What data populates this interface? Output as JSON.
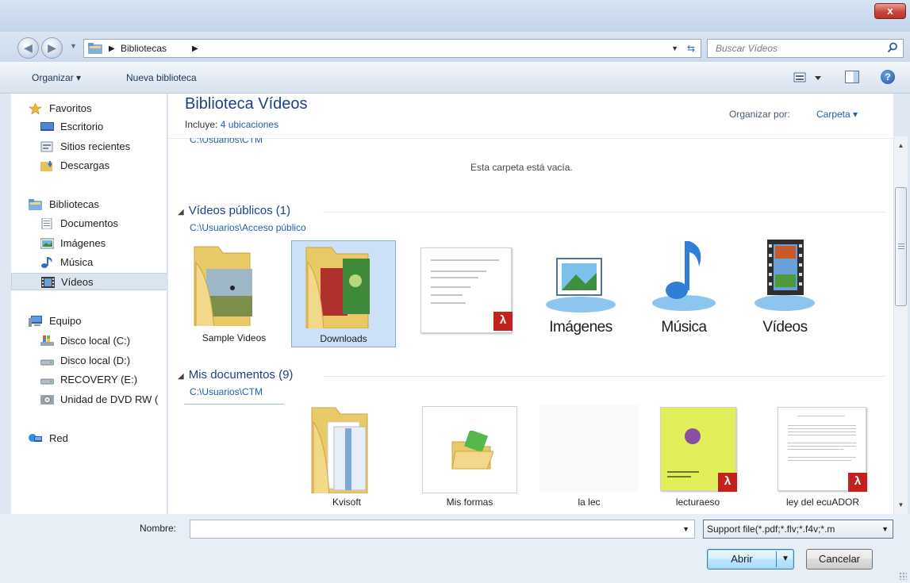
{
  "window": {
    "close_symbol": "x"
  },
  "address": {
    "breadcrumb": "Bibliotecas",
    "search_placeholder": "Buscar Vídeos"
  },
  "toolbar": {
    "organize": "Organizar ▾",
    "new_library": "Nueva biblioteca"
  },
  "nav": {
    "favorites": "Favoritos",
    "desktop": "Escritorio",
    "recent": "Sitios recientes",
    "downloads": "Descargas",
    "libraries": "Bibliotecas",
    "documents": "Documentos",
    "images": "Imágenes",
    "music": "Música",
    "videos": "Vídeos",
    "computer": "Equipo",
    "disk_c": "Disco local (C:)",
    "disk_d": "Disco local (D:)",
    "recovery": "RECOVERY (E:)",
    "dvd": "Unidad de DVD RW (",
    "network": "Red"
  },
  "library": {
    "title": "Biblioteca Vídeos",
    "includes_label": "Incluye:",
    "includes_link": "4 ubicaciones",
    "arrange_label": "Organizar por:",
    "arrange_value": "Carpeta ▾",
    "partial_path": "C:\\Usuarios\\CTM",
    "empty_message": "Esta carpeta está vacía."
  },
  "groups": {
    "public": {
      "title": "Vídeos públicos (1)",
      "path": "C:\\Usuarios\\Acceso público"
    },
    "mydocs": {
      "title": "Mis documentos (9)",
      "path": "C:\\Usuarios\\CTM"
    }
  },
  "public_items": {
    "sample": "Sample Videos",
    "downloads": "Downloads",
    "images": "Imágenes",
    "music": "Música",
    "videos": "Vídeos"
  },
  "doc_items": {
    "kvisoft": "Kvisoft",
    "forms": "Mis formas",
    "lalec": "la lec",
    "lectura": "lecturaeso",
    "ley": "ley del ecuADOR"
  },
  "bottom": {
    "name_label": "Nombre:",
    "name_value": "",
    "filter": "Support file(*.pdf;*.flv;*.f4v;*.m",
    "open": "Abrir",
    "cancel": "Cancelar"
  }
}
